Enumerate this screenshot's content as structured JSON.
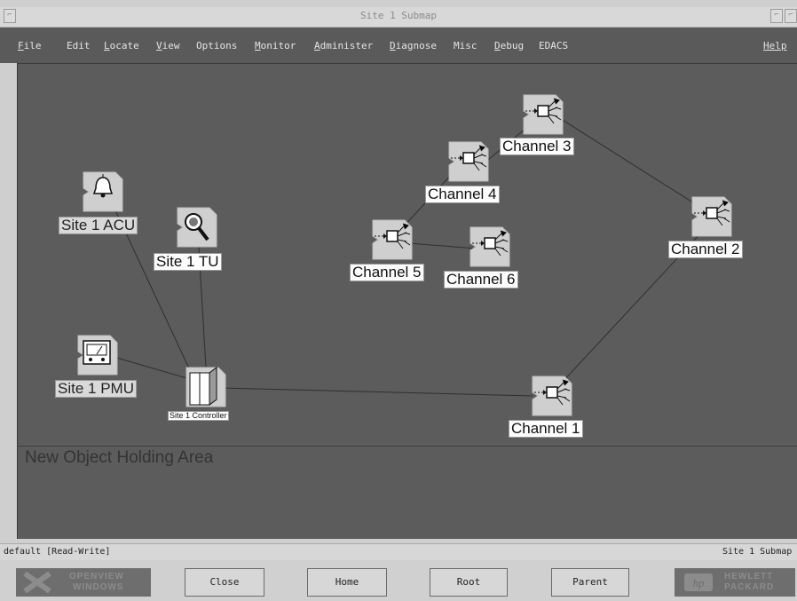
{
  "window": {
    "title": "Site 1 Submap"
  },
  "menubar": {
    "items": [
      {
        "mnemonic": "F",
        "rest": "ile"
      },
      {
        "mnemonic": "",
        "rest": "Edit"
      },
      {
        "mnemonic": "L",
        "rest": "ocate"
      },
      {
        "mnemonic": "V",
        "rest": "iew"
      },
      {
        "mnemonic": "",
        "rest": "Options"
      },
      {
        "mnemonic": "M",
        "rest": "onitor"
      },
      {
        "mnemonic": "A",
        "rest": "dminister"
      },
      {
        "mnemonic": "D",
        "rest": "iagnose"
      },
      {
        "mnemonic": "",
        "rest": "Misc"
      },
      {
        "mnemonic": "D",
        "rest": "ebug"
      },
      {
        "mnemonic": "",
        "rest": "EDACS"
      }
    ],
    "help": "Help"
  },
  "map": {
    "nodes": {
      "acu": {
        "label": "Site 1 ACU",
        "icon": "bell-icon"
      },
      "tu": {
        "label": "Site 1 TU",
        "icon": "magnifier-icon"
      },
      "pmu": {
        "label": "Site 1 PMU",
        "icon": "meter-icon"
      },
      "controller": {
        "label": "Site 1 Controller",
        "icon": "cabinet-icon"
      },
      "ch1": {
        "label": "Channel 1",
        "icon": "channel-icon"
      },
      "ch2": {
        "label": "Channel 2",
        "icon": "channel-icon"
      },
      "ch3": {
        "label": "Channel 3",
        "icon": "channel-icon"
      },
      "ch4": {
        "label": "Channel 4",
        "icon": "channel-icon"
      },
      "ch5": {
        "label": "Channel 5",
        "icon": "channel-icon"
      },
      "ch6": {
        "label": "Channel 6",
        "icon": "channel-icon"
      }
    },
    "holding_area": "New Object Holding Area"
  },
  "status": {
    "left": "default [Read-Write]",
    "right": "Site 1 Submap"
  },
  "buttons": {
    "close": "Close",
    "home": "Home",
    "root": "Root",
    "parent": "Parent"
  },
  "logos": {
    "left_line1": "OPENVIEW",
    "left_line2": "WINDOWS",
    "right_line1": "HEWLETT",
    "right_line2": "PACKARD"
  }
}
